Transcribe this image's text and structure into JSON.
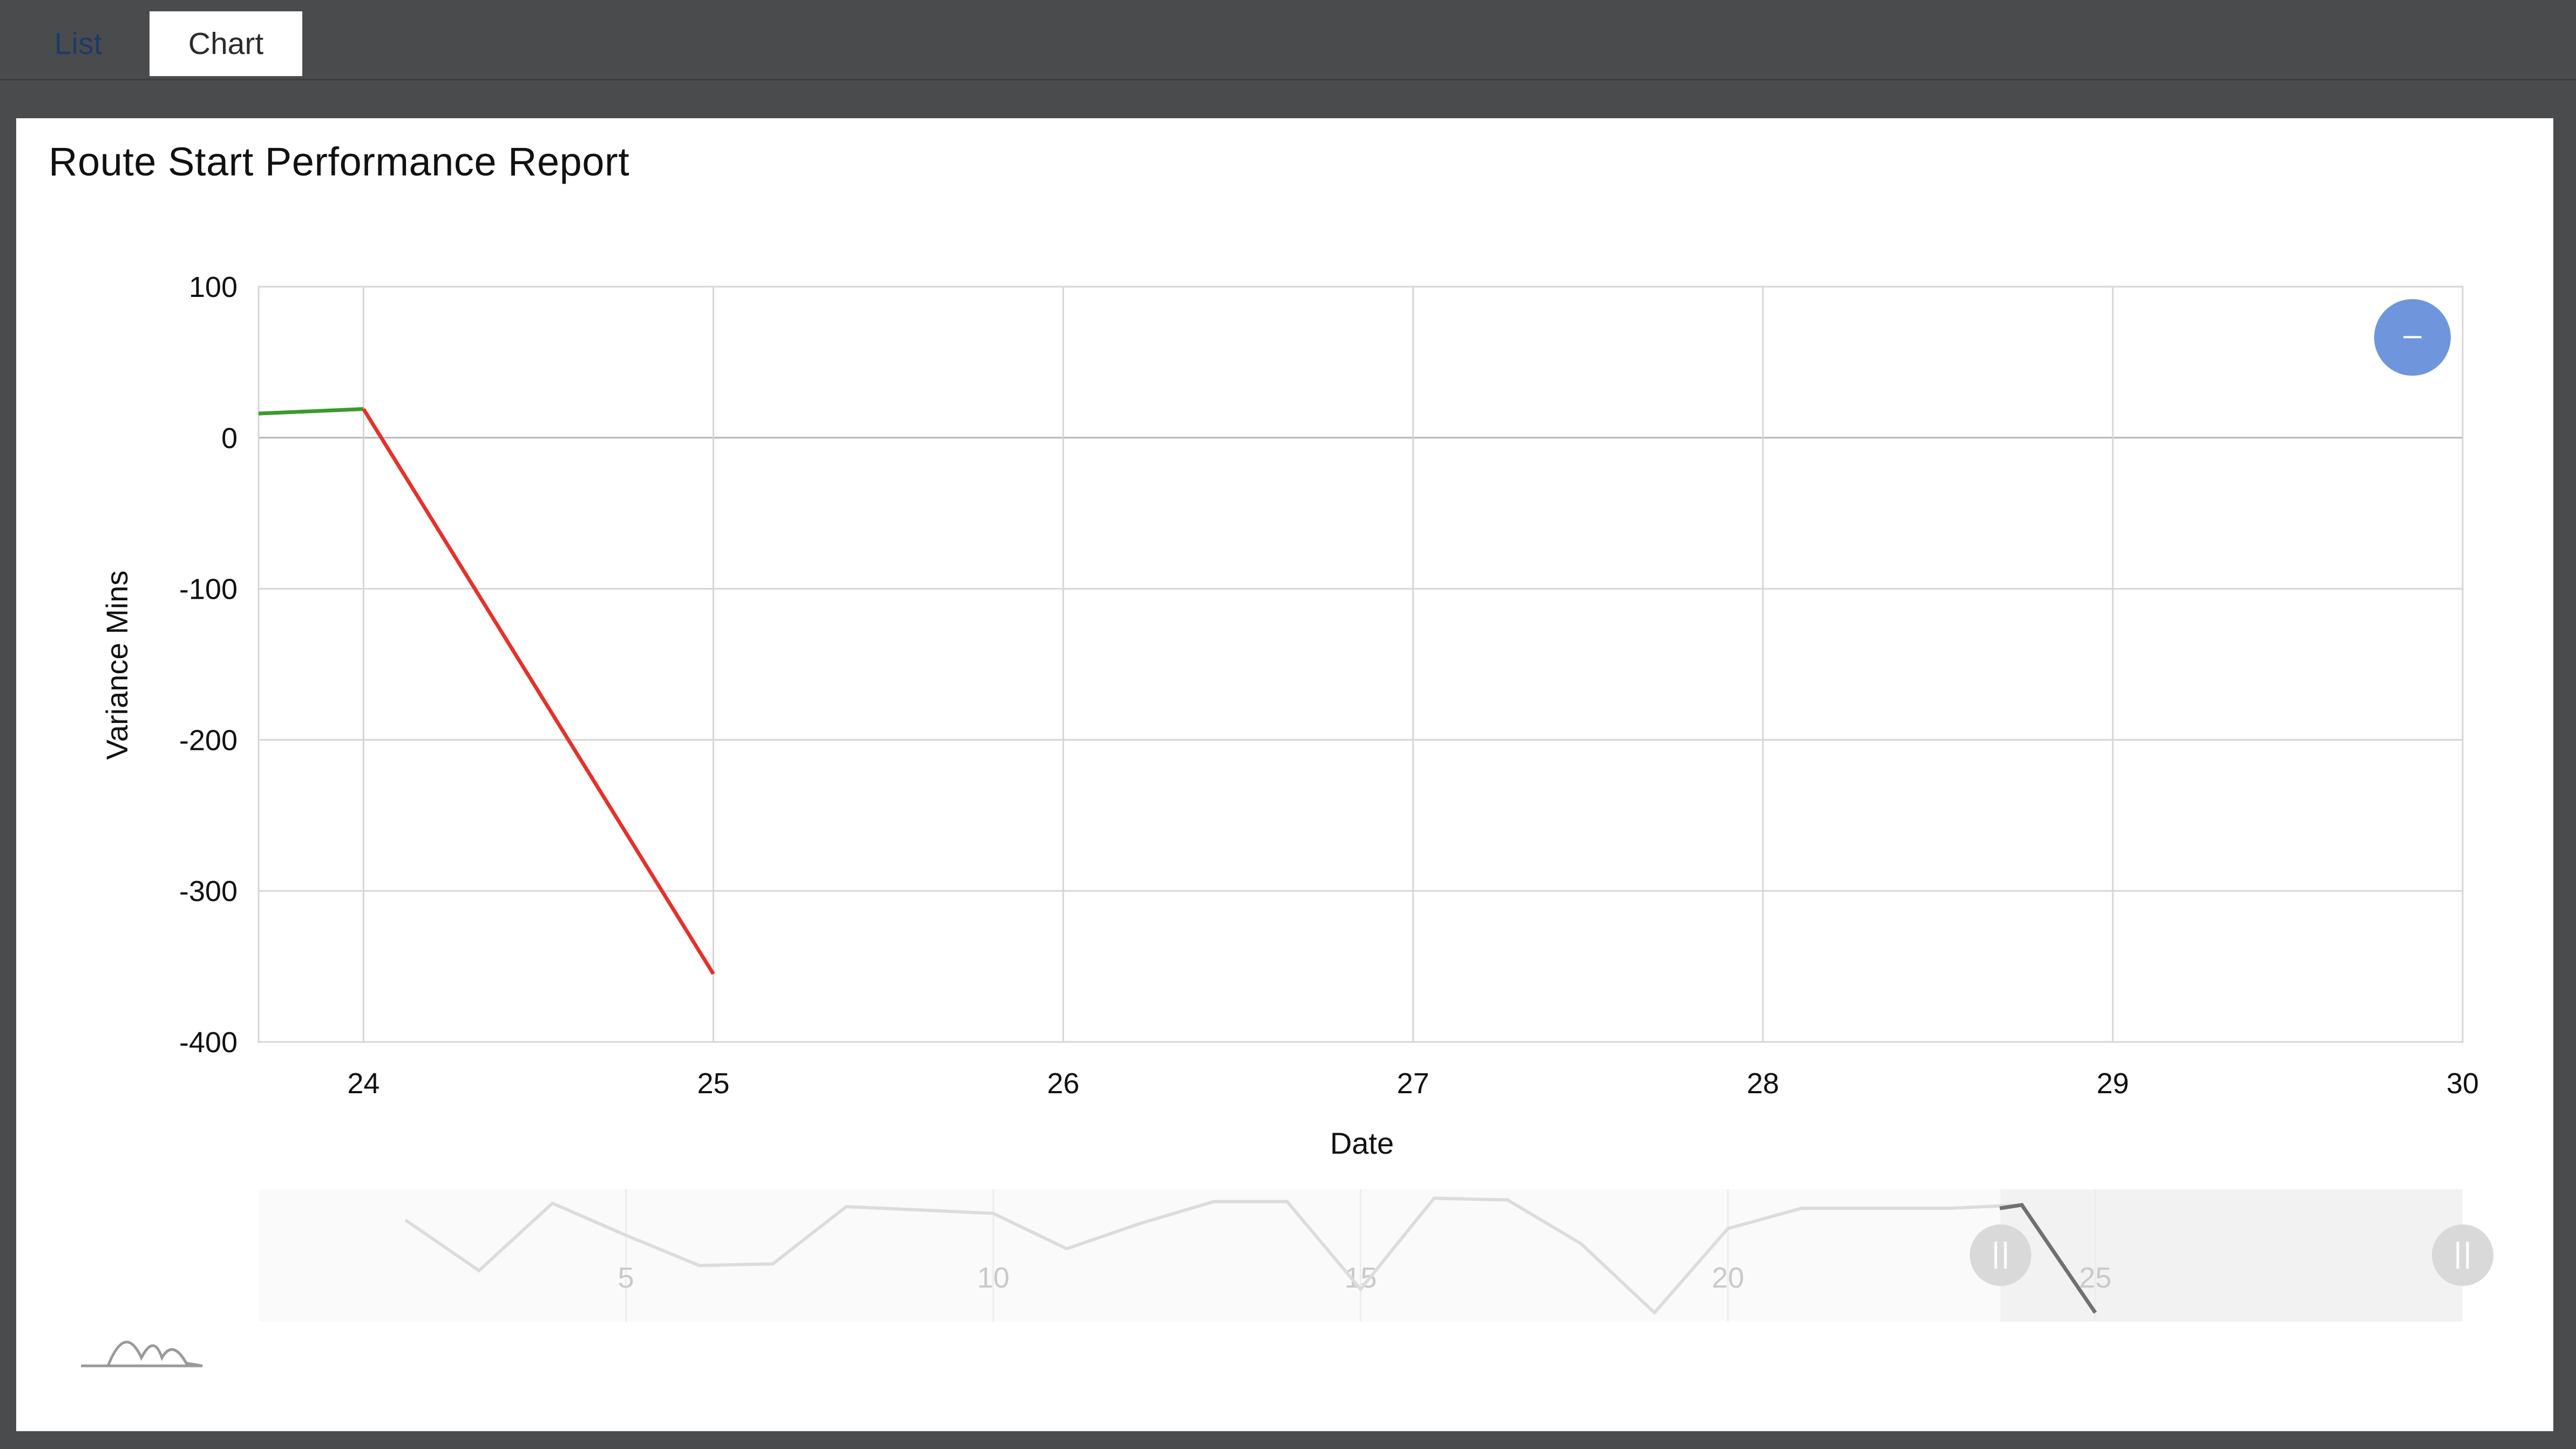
{
  "tabs": [
    {
      "label": "List",
      "active": false
    },
    {
      "label": "Chart",
      "active": true
    }
  ],
  "report": {
    "title": "Route Start Performance Report"
  },
  "zoom_button": {
    "symbol": "–",
    "color": "#6f96dc"
  },
  "chart_data": {
    "type": "line",
    "title": "Route Start Performance Report",
    "xlabel": "Date",
    "ylabel": "Variance Mins",
    "xlim": [
      23.7,
      30
    ],
    "ylim": [
      -400,
      100
    ],
    "x_ticks": [
      "24",
      "25",
      "26",
      "27",
      "28",
      "29",
      "30"
    ],
    "y_ticks": [
      "100",
      "0",
      "-100",
      "-200",
      "-300",
      "-400"
    ],
    "grid": true,
    "series": [
      {
        "x": [
          23.7,
          24
        ],
        "y": [
          16,
          19
        ],
        "color": "#3a9a2c"
      },
      {
        "x": [
          24,
          25
        ],
        "y": [
          19,
          -355
        ],
        "color": "#e4322b"
      }
    ],
    "navigator": {
      "x_labels": [
        "5",
        "10",
        "15",
        "20",
        "25"
      ],
      "x": [
        2,
        3,
        4,
        5,
        6,
        7,
        8,
        9,
        10,
        11,
        12,
        13,
        14,
        15,
        16,
        17,
        18,
        19,
        20,
        21,
        22,
        23,
        24,
        25
      ],
      "y": [
        -5,
        -35,
        5,
        -14,
        -32,
        -31,
        3,
        1,
        -1,
        -22,
        -7,
        6,
        6,
        -46,
        8,
        7,
        -19,
        -60,
        -10,
        2,
        2,
        2,
        4,
        -60
      ],
      "selected_range": [
        23.7,
        30
      ]
    }
  }
}
